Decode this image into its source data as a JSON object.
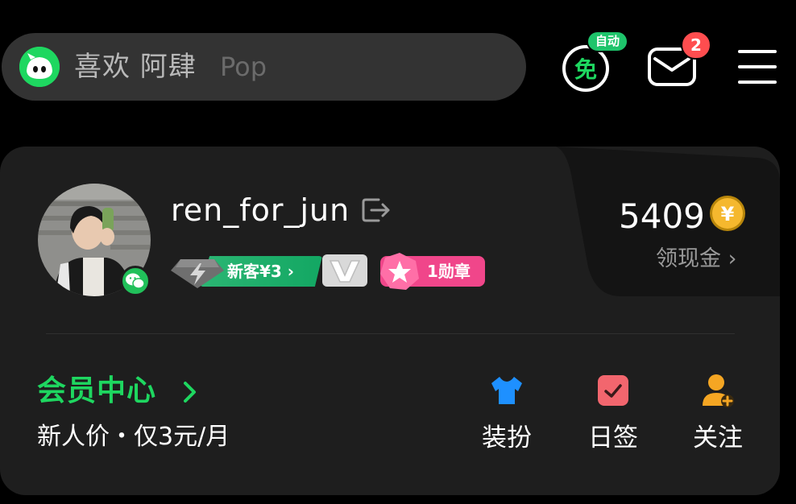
{
  "search": {
    "hint_text": "喜欢 阿肆",
    "hint_sub": "Pop"
  },
  "header": {
    "auto_badge": "自动",
    "free_icon": "free-listen-icon",
    "mail_icon": "mail-icon",
    "mail_count": "2",
    "menu_icon": "hamburger-menu-icon"
  },
  "profile": {
    "username": "ren_for_jun",
    "newbie_offer": "新客¥3",
    "medal_label": "1勋章",
    "coins": "5409",
    "cash_link": "领现金 ›"
  },
  "vip": {
    "title": "会员中心",
    "subtitle": "新人价・仅3元/月"
  },
  "shortcuts": [
    {
      "label": "装扮",
      "icon": "tshirt-icon",
      "color": "#1e90ff"
    },
    {
      "label": "日签",
      "icon": "checkin-icon",
      "color": "#f2666e"
    },
    {
      "label": "关注",
      "icon": "follow-user-icon",
      "color": "#f5a623"
    }
  ],
  "colors": {
    "accent": "#1ed760",
    "badge_red": "#ff4d4f",
    "medal_pink": "#f0468a",
    "card_bg": "#1e1e1e"
  }
}
